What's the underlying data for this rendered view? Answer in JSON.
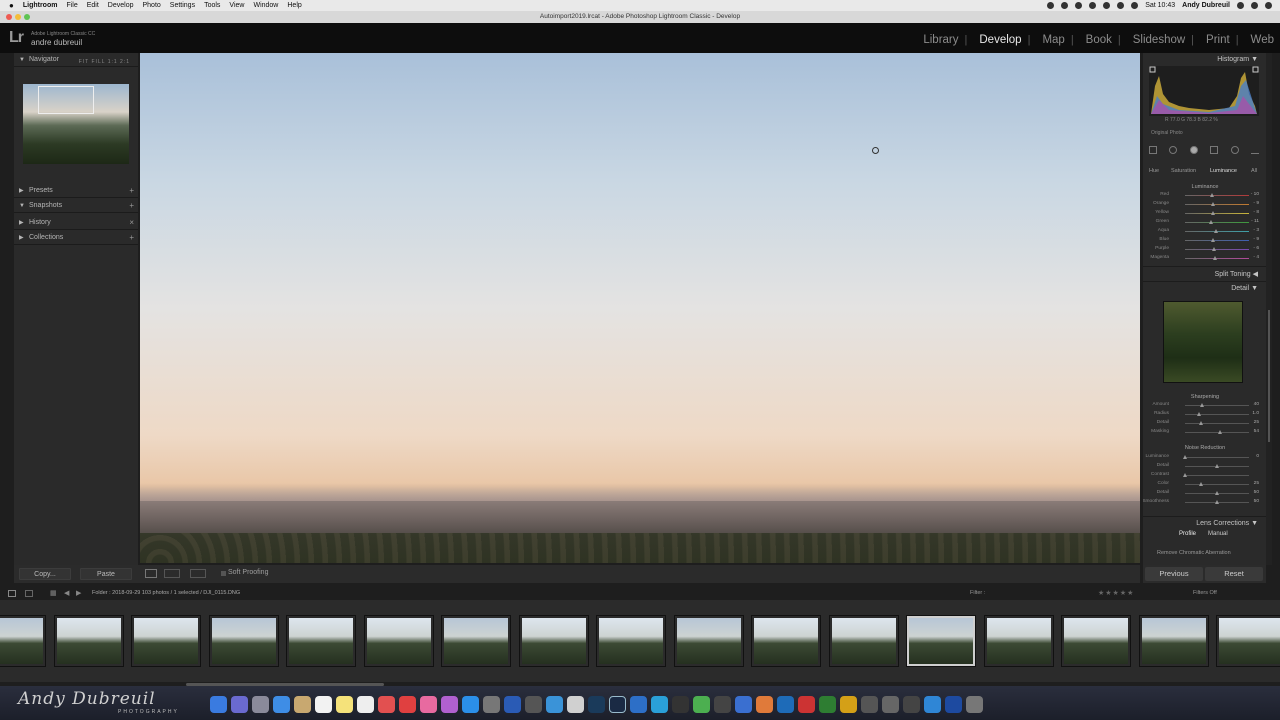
{
  "menubar": {
    "apple": "",
    "items": [
      "Lightroom",
      "File",
      "Edit",
      "Develop",
      "Photo",
      "Settings",
      "Tools",
      "View",
      "Window",
      "Help"
    ],
    "clock": "Sat 10:43",
    "user": "Andy Dubreuil"
  },
  "window": {
    "title": "Autoimport2019.lrcat - Adobe Photoshop Lightroom Classic - Develop"
  },
  "identity": {
    "logo": "Lr",
    "line1": "Adobe Lightroom Classic CC",
    "line2": "andre dubreuil"
  },
  "modules": [
    "Library",
    "Develop",
    "Map",
    "Book",
    "Slideshow",
    "Print",
    "Web"
  ],
  "active_module": "Develop",
  "left_panel": {
    "navigator": "Navigator",
    "zoom_options": "FIT  FILL  1:1  2:1",
    "presets": "Presets",
    "snapshots": "Snapshots",
    "history": "History",
    "collections": "Collections",
    "copy_button": "Copy...",
    "paste_button": "Paste"
  },
  "toolbar": {
    "soft_proofing": "Soft Proofing"
  },
  "right_panel": {
    "histogram": "Histogram",
    "histo_readout": "R  77.0   G  78.3   B  82.2  %",
    "original_photo": "Original Photo",
    "hsl_tabs": [
      "Hue",
      "Saturation",
      "Luminance",
      "All"
    ],
    "hsl_active": "Luminance",
    "luminance_title": "Luminance",
    "luminance_sliders": [
      {
        "label": "Red",
        "value": "- 10",
        "pos": 0.42,
        "color": "#b23a3a"
      },
      {
        "label": "Orange",
        "value": "- 9",
        "pos": 0.43,
        "color": "#c27a30"
      },
      {
        "label": "Yellow",
        "value": "- 8",
        "pos": 0.44,
        "color": "#c8b43a"
      },
      {
        "label": "Green",
        "value": "- 11",
        "pos": 0.41,
        "color": "#3e9a3e"
      },
      {
        "label": "Aqua",
        "value": "- 3",
        "pos": 0.48,
        "color": "#3ea0a8"
      },
      {
        "label": "Blue",
        "value": "- 9",
        "pos": 0.43,
        "color": "#3e5fb0"
      },
      {
        "label": "Purple",
        "value": "- 6",
        "pos": 0.46,
        "color": "#7a4ab0"
      },
      {
        "label": "Magenta",
        "value": "- 4",
        "pos": 0.47,
        "color": "#b04a9a"
      }
    ],
    "split_toning": "Split Toning",
    "detail": "Detail",
    "sharpening_title": "Sharpening",
    "sharpening_sliders": [
      {
        "label": "Amount",
        "value": "40",
        "pos": 0.26
      },
      {
        "label": "Radius",
        "value": "1.0",
        "pos": 0.22
      },
      {
        "label": "Detail",
        "value": "25",
        "pos": 0.25
      },
      {
        "label": "Masking",
        "value": "54",
        "pos": 0.54
      }
    ],
    "noise_title": "Noise Reduction",
    "noise_sliders": [
      {
        "label": "Luminance",
        "value": "0",
        "pos": 0.0
      },
      {
        "label": "Detail",
        "value": "",
        "pos": 0.5
      },
      {
        "label": "Contrast",
        "value": "",
        "pos": 0.0
      },
      {
        "label": "Color",
        "value": "25",
        "pos": 0.25
      },
      {
        "label": "Detail",
        "value": "50",
        "pos": 0.5
      },
      {
        "label": "Smoothness",
        "value": "50",
        "pos": 0.5
      }
    ],
    "lens_corrections": "Lens Corrections",
    "profile_tab": "Profile",
    "manual_tab": "Manual",
    "remove_ca": "Remove Chromatic Aberration",
    "previous_button": "Previous",
    "reset_button": "Reset"
  },
  "filmstrip": {
    "path": "Folder : 2018-09-29     103 photos / 1 selected / DJI_0115.DNG",
    "filter_label": "Filter :",
    "filters_off": "Filters Off",
    "thumbs": [
      "t1",
      "t2",
      "t3",
      "t4",
      "t5",
      "t6",
      "t7",
      "t8",
      "t9",
      "t10",
      "t11",
      "t12",
      "t13",
      "t14",
      "t15",
      "t16",
      "t17"
    ],
    "selected_index": 12
  },
  "dock": {
    "signature": "Andy Dubreuil",
    "signature_sub": "PHOTOGRAPHY"
  }
}
